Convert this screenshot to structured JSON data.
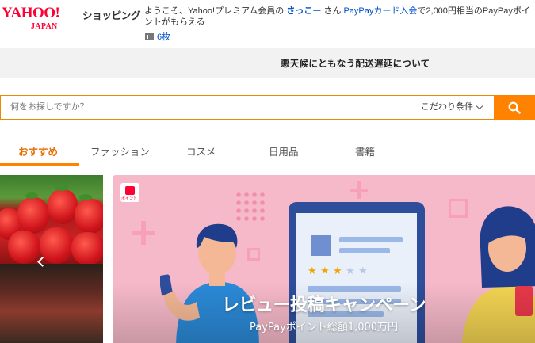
{
  "header": {
    "logo_main": "YAHOO!",
    "logo_sub": "JAPAN",
    "service_label": "ショッピング",
    "welcome_prefix": "ようこそ、Yahoo!プレミアム会員の",
    "user_name": "さっこー",
    "welcome_suffix": "さん",
    "promo_link": "PayPayカード入会",
    "promo_rest": "で2,000円相当のPayPayポイントがもらえる",
    "coupon_count": "6枚"
  },
  "notice": {
    "text": "悪天候にともなう配送遅延について"
  },
  "search": {
    "placeholder": "何をお探しですか？",
    "filter_label": "こだわり条件"
  },
  "tabs": [
    {
      "label": "おすすめ",
      "active": true
    },
    {
      "label": "ファッション",
      "active": false
    },
    {
      "label": "コスメ",
      "active": false
    },
    {
      "label": "日用品",
      "active": false
    },
    {
      "label": "書籍",
      "active": false
    }
  ],
  "banner": {
    "title": "レビュー投稿キャンペーン",
    "subtitle": "PayPayポイント総額1,000万円",
    "bg_color": "#f6b9c9"
  },
  "colors": {
    "accent": "#ff8200",
    "brand": "#ff0033",
    "link": "#0050c8"
  }
}
